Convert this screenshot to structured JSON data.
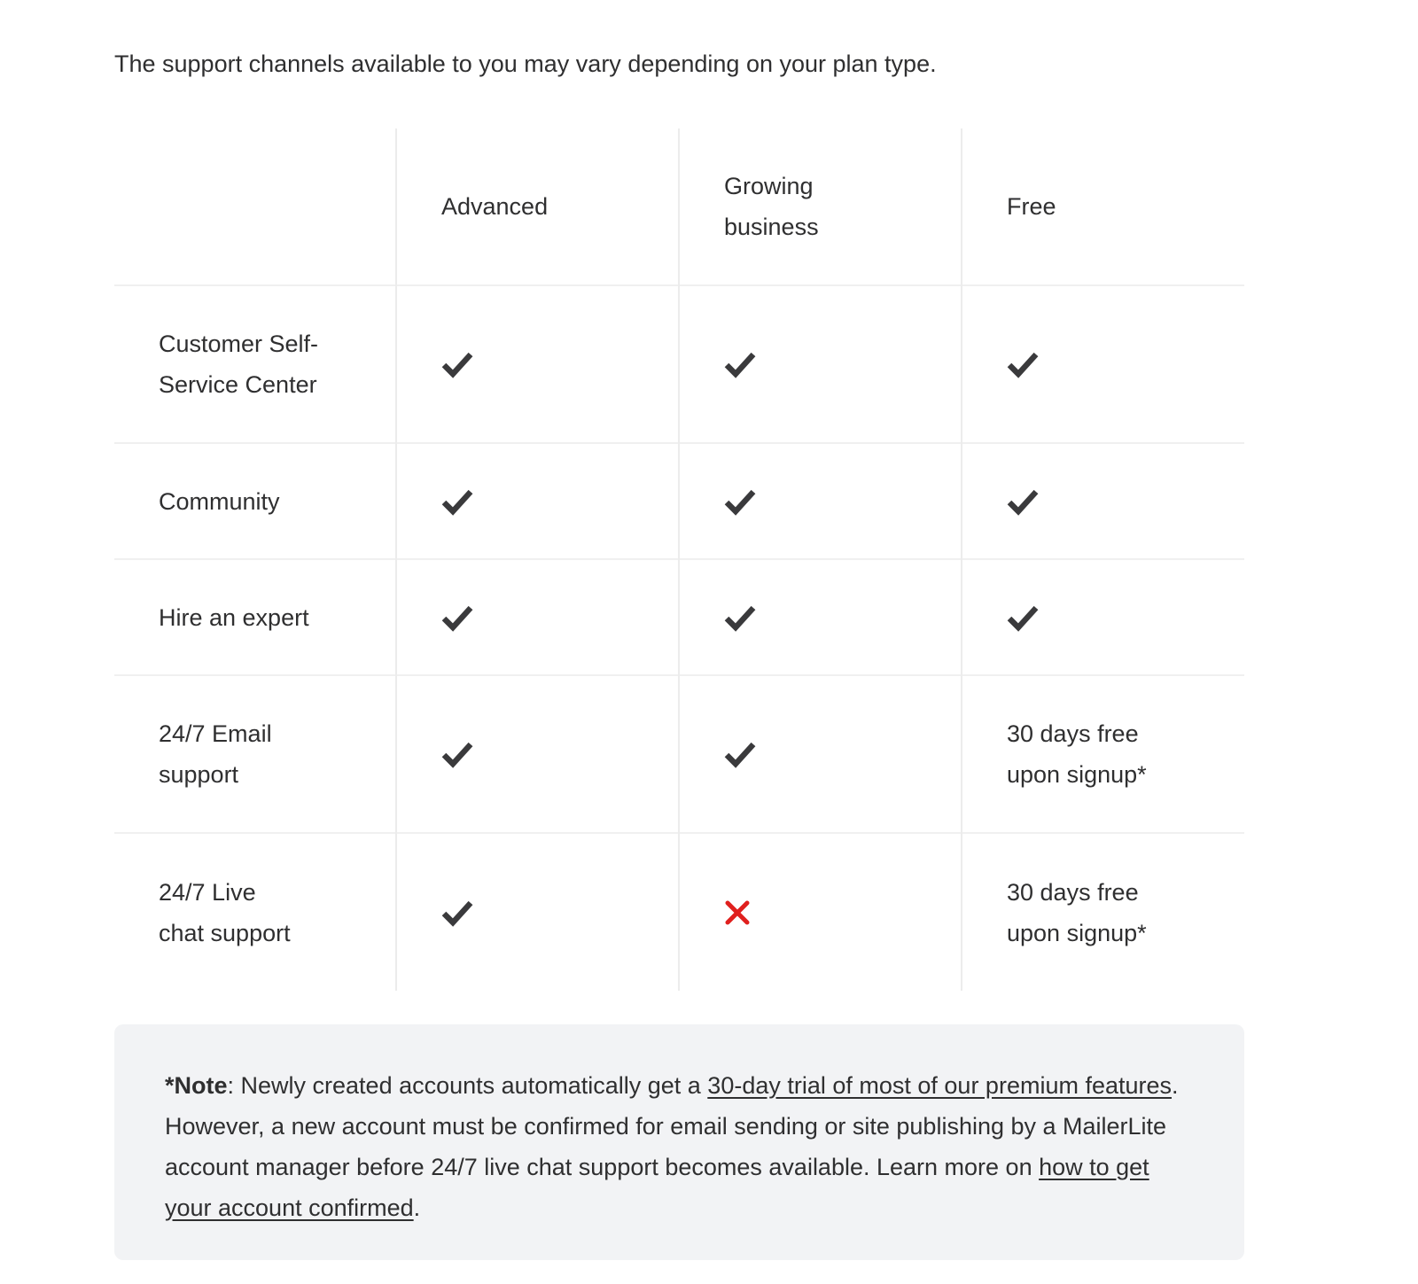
{
  "intro_text": "The support channels available to you may vary depending on your plan type.",
  "table": {
    "columns": [
      "",
      "Advanced",
      "Growing business",
      "Free"
    ],
    "rows": [
      {
        "label": "Customer Self-Service Center",
        "advanced": "check",
        "growing": "check",
        "free": "check"
      },
      {
        "label": "Community",
        "advanced": "check",
        "growing": "check",
        "free": "check"
      },
      {
        "label": "Hire an expert",
        "advanced": "check",
        "growing": "check",
        "free": "check"
      },
      {
        "label": "24/7 Email support",
        "advanced": "check",
        "growing": "check",
        "free": "30 days free upon signup*"
      },
      {
        "label": "24/7 Live chat support",
        "advanced": "check",
        "growing": "cross",
        "free": "30 days free upon signup*"
      }
    ]
  },
  "icons": {
    "check": {
      "name": "checkmark-icon",
      "color": "#3a3a3c"
    },
    "cross": {
      "name": "cross-icon",
      "color": "#e0201e"
    }
  },
  "note": {
    "label": "*Note",
    "text_1": ": Newly created accounts automatically get a ",
    "link_1": "30-day trial of most of our premium features",
    "text_2": ". However, a new account must be confirmed for email sending or site publishing by a MailerLite account manager before 24/7 live chat support becomes available. Learn more on ",
    "link_2": "how to get your account confirmed",
    "text_3": "."
  },
  "colors": {
    "text": "#2f2f30",
    "note_background": "#f2f3f5",
    "border": "#ececec"
  }
}
